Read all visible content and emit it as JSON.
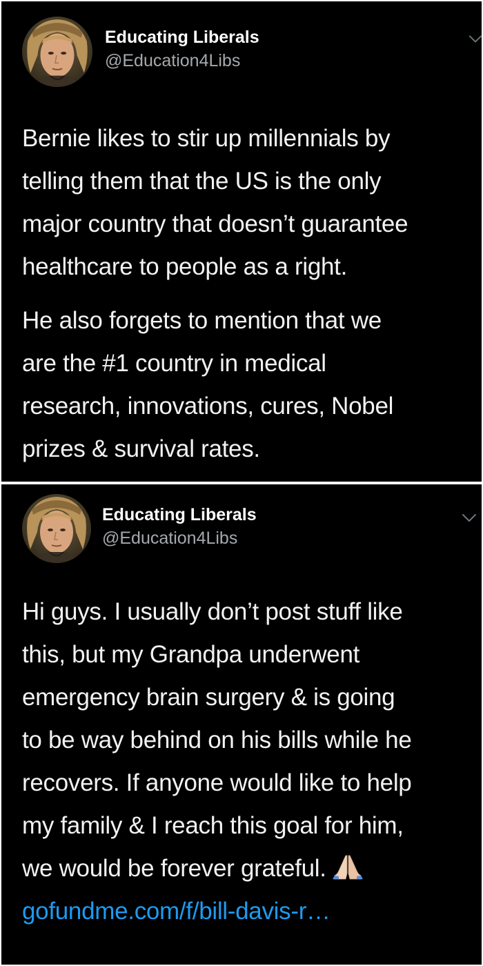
{
  "tweets": [
    {
      "author_name": "Educating Liberals",
      "author_handle": "@Education4Libs",
      "avatar_icon": "profile-photo",
      "menu_icon": "chevron-down-icon",
      "paragraphs": [
        [
          "Bernie likes to stir up millennials by",
          "telling them that the US is the only",
          "major country that doesn’t guarantee",
          "healthcare to people as a right."
        ],
        [
          "He also forgets to mention that we",
          "are the #1 country in medical",
          "research, innovations, cures, Nobel",
          "prizes & survival rates."
        ]
      ]
    },
    {
      "author_name": "Educating Liberals",
      "author_handle": "@Education4Libs",
      "avatar_icon": "profile-photo",
      "menu_icon": "chevron-down-icon",
      "paragraphs": [
        [
          "Hi guys. I usually don’t post stuff like",
          "this, but my Grandpa underwent",
          "emergency brain surgery & is going",
          "to be way behind on his bills while he",
          "recovers. If anyone would like to help",
          "my family & I reach this goal for him,",
          "we would be forever grateful."
        ]
      ],
      "emoji": "folded-hands",
      "link_text": "gofundme.com/f/bill-davis-r…"
    }
  ],
  "colors": {
    "background": "#000000",
    "text": "#f2f2f2",
    "handle": "#a5a9ad",
    "link": "#1d9bf0",
    "divider": "#ffffff"
  }
}
